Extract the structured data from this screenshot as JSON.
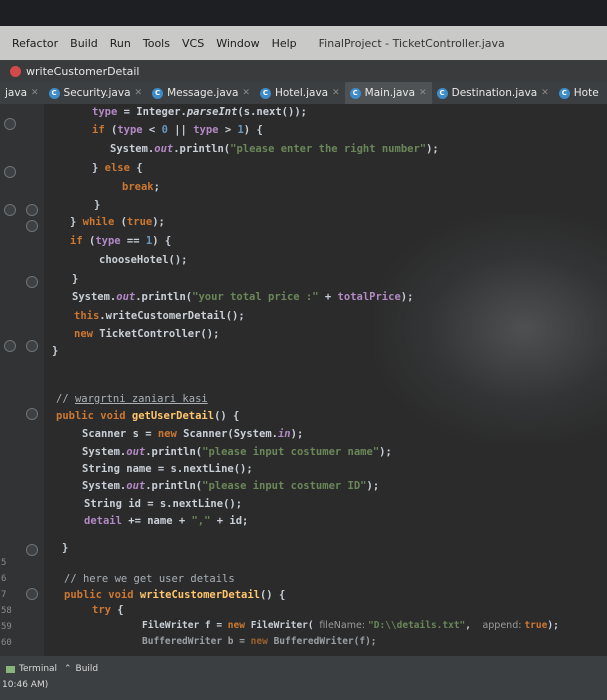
{
  "menubar": {
    "items": [
      "Refactor",
      "Build",
      "Run",
      "Tools",
      "VCS",
      "Window",
      "Help"
    ],
    "window_title": "FinalProject - TicketController.java"
  },
  "run_config": {
    "label": "writeCustomerDetail"
  },
  "tabs": [
    {
      "label": "java",
      "icon": "class-icon",
      "closable": true
    },
    {
      "label": "Security.java",
      "icon": "class-icon",
      "closable": true
    },
    {
      "label": "Message.java",
      "icon": "class-icon",
      "closable": true
    },
    {
      "label": "Hotel.java",
      "icon": "class-icon",
      "closable": true
    },
    {
      "label": "Main.java",
      "icon": "class-icon",
      "closable": true
    },
    {
      "label": "Destination.java",
      "icon": "class-icon",
      "closable": true
    },
    {
      "label": "Hote",
      "icon": "class-icon",
      "closable": false
    }
  ],
  "gutter": {
    "line_numbers": [
      "5",
      "6",
      "7",
      "58",
      "59",
      "60"
    ]
  },
  "code": {
    "l1_a": "type",
    "l1_b": " = Integer.",
    "l1_c": "parseInt",
    "l1_d": "(s.next());",
    "l2_a": "if",
    "l2_b": " (",
    "l2_c": "type",
    "l2_d": " < ",
    "l2_e": "0",
    "l2_f": " || ",
    "l2_g": "type",
    "l2_h": " > ",
    "l2_i": "1",
    "l2_j": ") {",
    "l3_a": "System.",
    "l3_b": "out",
    "l3_c": ".println(",
    "l3_d": "\"please enter the right number\"",
    "l3_e": ");",
    "l4_a": "} ",
    "l4_b": "else",
    "l4_c": " {",
    "l5_a": "break",
    "l5_b": ";",
    "l6_a": "}",
    "l7_a": "} ",
    "l7_b": "while",
    "l7_c": " (",
    "l7_d": "true",
    "l7_e": ");",
    "l8_a": "if",
    "l8_b": " (",
    "l8_c": "type",
    "l8_d": " == ",
    "l8_e": "1",
    "l8_f": ") {",
    "l9_a": "chooseHotel();",
    "l10_a": "}",
    "l11_a": "System.",
    "l11_b": "out",
    "l11_c": ".println(",
    "l11_d": "\"your total price :\"",
    "l11_e": " + ",
    "l11_f": "totalPrice",
    "l11_g": ");",
    "l12_a": "this",
    "l12_b": ".writeCustomerDetail();",
    "l13_a": "new",
    "l13_b": " TicketController();",
    "l14_a": "}",
    "l15_a": "// ",
    "l15_b": "wargrtni zaniari kasi",
    "l16_a": "public void",
    "l16_b": " ",
    "l16_c": "getUserDetail",
    "l16_d": "() {",
    "l17_a": "Scanner s = ",
    "l17_b": "new",
    "l17_c": " Scanner(System.",
    "l17_d": "in",
    "l17_e": ");",
    "l18_a": "System.",
    "l18_b": "out",
    "l18_c": ".println(",
    "l18_d": "\"please input costumer name\"",
    "l18_e": ");",
    "l19_a": "String name = s.nextLine();",
    "l20_a": "System.",
    "l20_b": "out",
    "l20_c": ".println(",
    "l20_d": "\"please input costumer ID\"",
    "l20_e": ");",
    "l21_a": "String id = s.nextLine();",
    "l22_a": "detail",
    "l22_b": " += name + ",
    "l22_c": "\",\"",
    "l22_d": " + id;",
    "l23_a": "}",
    "l24_a": "// here we get user details",
    "l25_a": "public void",
    "l25_b": " ",
    "l25_c": "writeCustomerDetail",
    "l25_d": "() {",
    "l26_a": "try",
    "l26_b": " {",
    "l27_a": "FileWriter f = ",
    "l27_b": "new",
    "l27_c": " FileWriter( ",
    "l27_d": "fileName: ",
    "l27_e": "\"D:\\\\details.txt\"",
    "l27_f": ",  ",
    "l27_g": "append: ",
    "l27_h": "true",
    "l27_i": ");",
    "l28_a": "BufferedWriter b = ",
    "l28_b": "new",
    "l28_c": " BufferedWriter(f);"
  },
  "statusbar": {
    "terminal_label": "Terminal",
    "build_label": "Build",
    "time": "10:46 AM)"
  },
  "colors": {
    "keyword": "#cc7832",
    "string": "#6a8759",
    "number": "#6897bb",
    "field": "#b389c5",
    "method_decl": "#ffc66d",
    "editor_bg": "#2b2b2b"
  }
}
